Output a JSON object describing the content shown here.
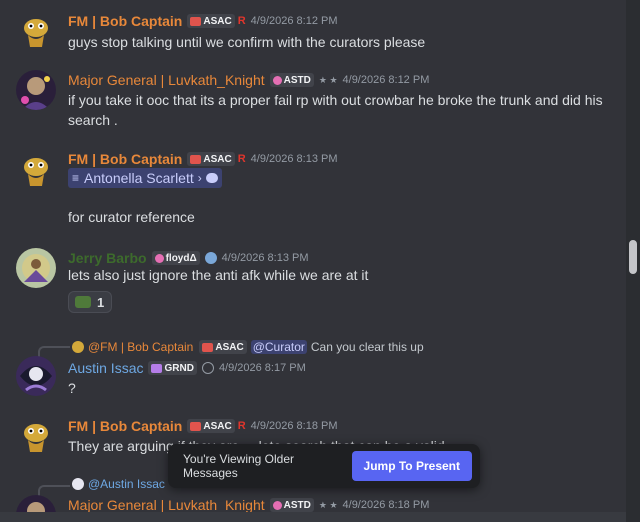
{
  "messages": [
    {
      "author": "FM | Bob Captain",
      "tag": "ASAC",
      "badge_r": "R",
      "timestamp": "4/9/2026 8:12 PM",
      "text": "guys stop talking until we confirm with the curators please"
    },
    {
      "author": "Major General | Luvkath_Knight",
      "tag": "ASTD",
      "stars": "★ ★",
      "timestamp": "4/9/2026 8:12 PM",
      "text": "if you take it ooc that its a proper fail rp with out crowbar he broke the trunk and did his search ."
    },
    {
      "author": "FM | Bob Captain",
      "tag": "ASAC",
      "badge_r": "R",
      "timestamp": "4/9/2026 8:13 PM",
      "mention": "Antonella Scarlett",
      "mention_arrow": "›",
      "text": "for curator reference"
    },
    {
      "author": "Jerry Barbo",
      "tag": "floydΔ",
      "timestamp": "4/9/2026 8:13 PM",
      "text": "lets also just ignore the anti afk while we are at it",
      "reaction_count": "1"
    },
    {
      "reply_author": "@FM | Bob Captain",
      "reply_tag": "ASAC",
      "reply_mention": "@Curator",
      "reply_text": "Can you clear this up",
      "author": "Austin Issac",
      "tag": "GRND",
      "timestamp": "4/9/2026 8:17 PM",
      "text": "?"
    },
    {
      "author": "FM | Bob Captain",
      "tag": "ASAC",
      "badge_r": "R",
      "timestamp": "4/9/2026 8:18 PM",
      "text": "They are arguing if they are ... lete search that can be a valid ..."
    },
    {
      "reply_author": "@Austin Issac",
      "author": "Major General | Luvkath_Knight",
      "tag": "ASTD",
      "stars": "★ ★",
      "timestamp": "4/9/2026 8:18 PM"
    }
  ],
  "toast": {
    "text": "You're Viewing Older Messages",
    "button": "Jump To Present"
  },
  "colors": {
    "background": "#323339",
    "accent": "#5865f2",
    "orange_name": "#e8883a",
    "blue_name": "#6ea8e3"
  }
}
